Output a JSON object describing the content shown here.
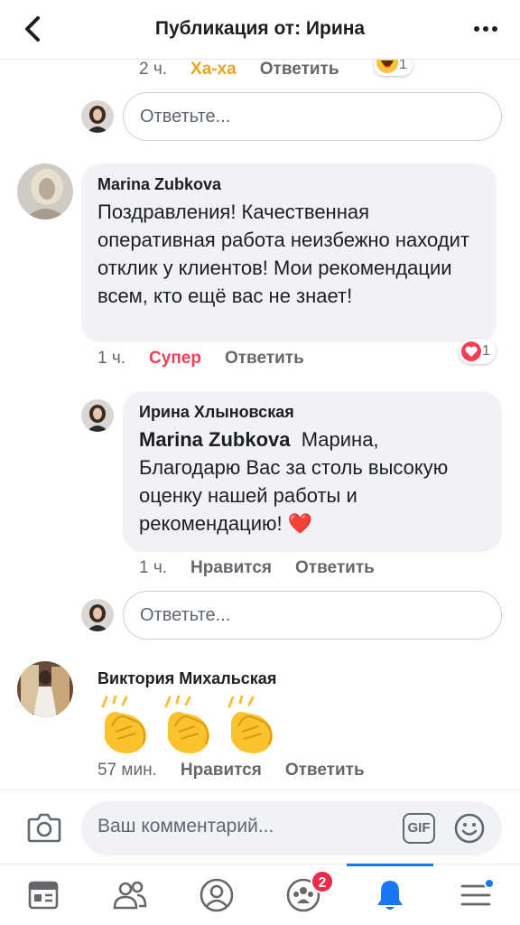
{
  "header": {
    "title": "Публикация от: Ирина",
    "back_icon": "chevron-left-icon",
    "more_icon": "ellipsis-icon"
  },
  "prev_comment_meta": {
    "time": "2 ч.",
    "reaction": "Ха-ха",
    "reply": "Ответить",
    "reaction_count": "1"
  },
  "reply_input_1": {
    "placeholder": "Ответьте..."
  },
  "comment_marina": {
    "author": "Marina Zubkova",
    "text": "Поздравления! Качественная оперативная работа неизбежно находит отклик у клиентов! Мои рекомендации всем, кто ещё вас не знает!",
    "time": "1 ч.",
    "reaction": "Супер",
    "reply": "Ответить",
    "reaction_count": "1"
  },
  "reply_irina": {
    "author": "Ирина Хлыновская",
    "mention": "Marina Zubkova",
    "text": "Марина, Благодарю Вас за столь высокую оценку нашей работы и рекомендацию!",
    "emoji": "❤️",
    "time": "1 ч.",
    "like": "Нравится",
    "reply": "Ответить"
  },
  "reply_input_2": {
    "placeholder": "Ответьте..."
  },
  "comment_viktoria": {
    "author": "Виктория Михальская",
    "emojis": [
      "👏",
      "👏",
      "👏"
    ],
    "time": "57 мин.",
    "like": "Нравится",
    "reply": "Ответить"
  },
  "composer": {
    "placeholder": "Ваш комментарий...",
    "camera_icon": "camera-icon",
    "gif_label": "GIF",
    "emoji_icon": "smiley-icon"
  },
  "tabbar": {
    "tabs": [
      {
        "name": "news-feed-icon"
      },
      {
        "name": "friends-icon"
      },
      {
        "name": "profile-icon"
      },
      {
        "name": "groups-icon",
        "badge": "2"
      },
      {
        "name": "notifications-icon",
        "active": true
      },
      {
        "name": "menu-icon"
      }
    ]
  },
  "colors": {
    "haha": "#e7a524",
    "love": "#f33e58",
    "accent": "#1877f2",
    "meta": "#65676b"
  }
}
